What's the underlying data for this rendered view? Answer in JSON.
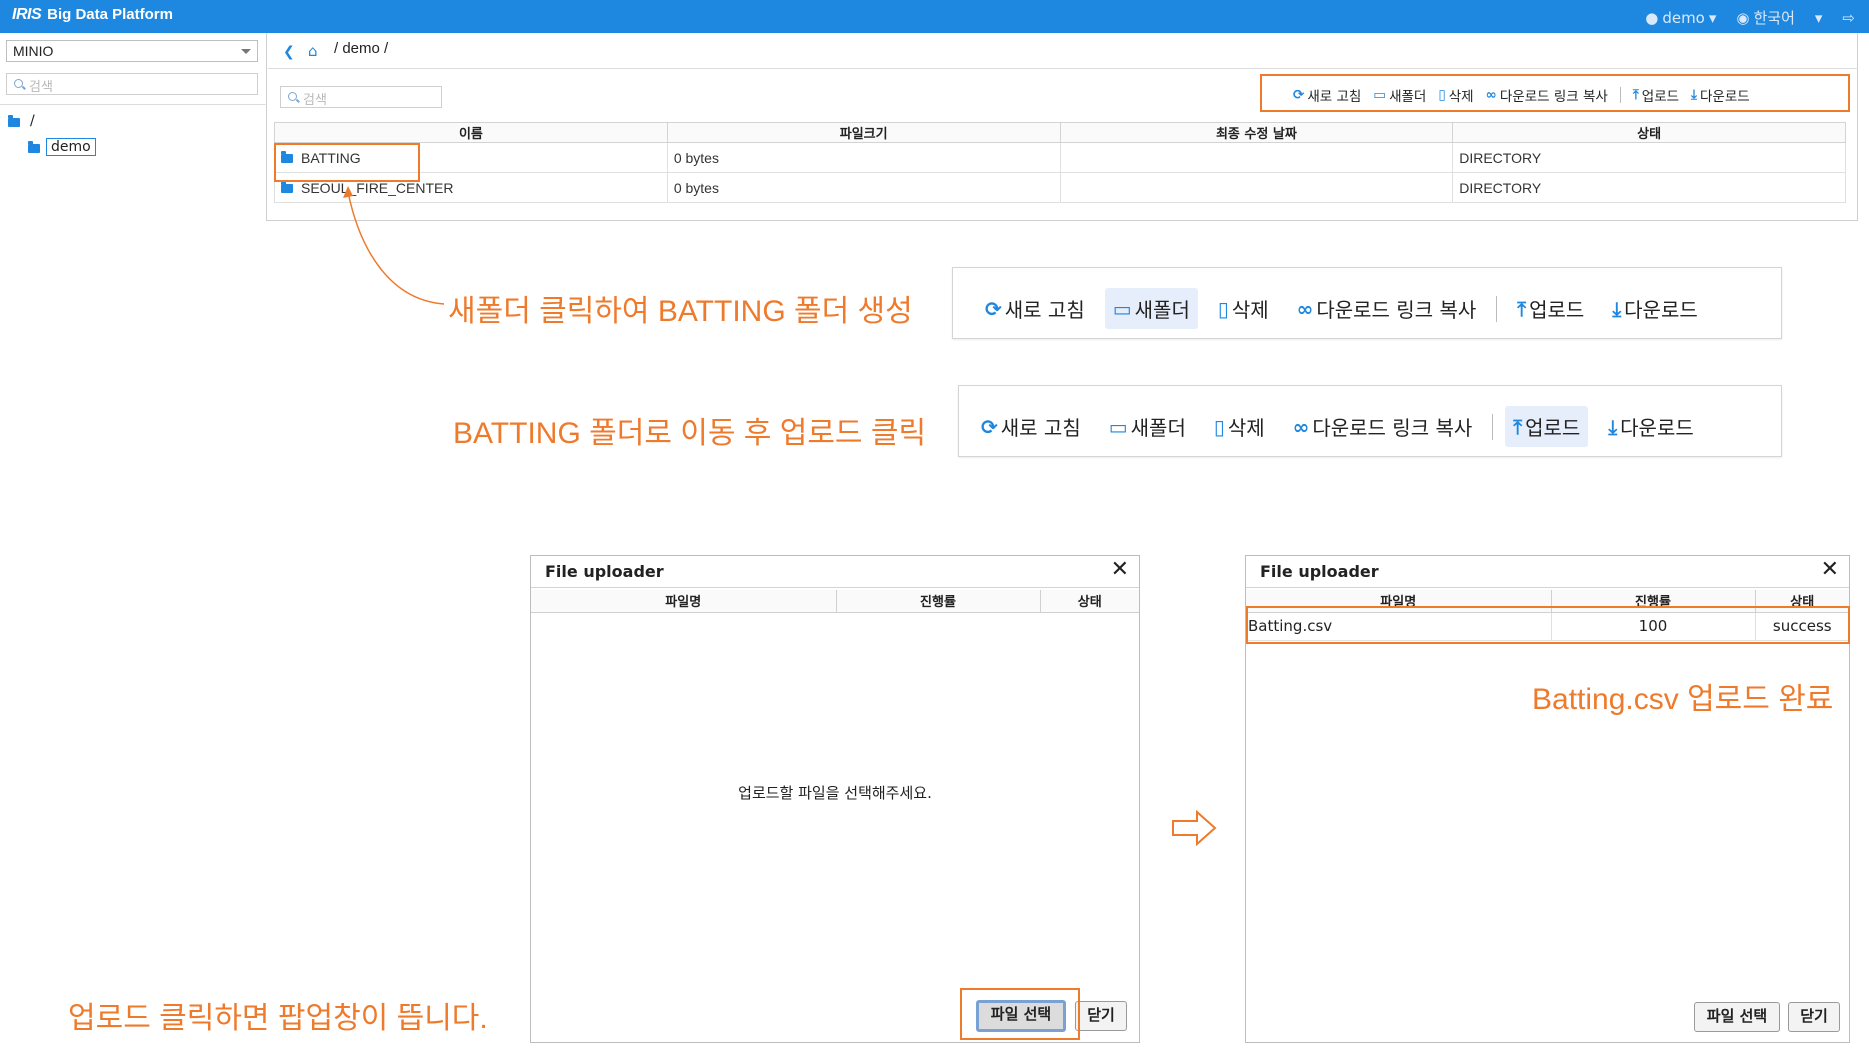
{
  "app": {
    "logo_mark": "IRIS",
    "title": "Big Data Platform",
    "user": "demo",
    "language": "한국어"
  },
  "sidebar": {
    "storage": "MINIO",
    "search_placeholder": "검색",
    "tree_root": "/",
    "tree_child": "demo"
  },
  "main": {
    "path": "/ demo /",
    "search_placeholder": "검색",
    "toolbar": {
      "refresh": "새로 고침",
      "new_folder": "새폴더",
      "delete": "삭제",
      "copy_link": "다운로드 링크 복사",
      "upload": "업로드",
      "download": "다운로드"
    },
    "columns": [
      "이름",
      "파일크기",
      "최종 수정 날짜",
      "상태"
    ],
    "rows": [
      {
        "name": "BATTING",
        "size": "0 bytes",
        "modified": "",
        "status": "DIRECTORY"
      },
      {
        "name": "SEOUL_FIRE_CENTER",
        "size": "0 bytes",
        "modified": "",
        "status": "DIRECTORY"
      }
    ]
  },
  "annotations": {
    "step1": "새폴더 클릭하여 BATTING 폴더 생성",
    "step2": "BATTING 폴더로 이동 후 업로드 클릭",
    "step3": "업로드 클릭하면 팝업창이 뜹니다.",
    "step4": "Batting.csv 업로드 완료",
    "accent_color": "#ee7a2c"
  },
  "uploader_empty": {
    "title": "File uploader",
    "columns": [
      "파일명",
      "진행률",
      "상태"
    ],
    "empty_message": "업로드할 파일을 선택해주세요.",
    "select_button": "파일 선택",
    "close_button": "닫기"
  },
  "uploader_done": {
    "title": "File uploader",
    "columns": [
      "파일명",
      "진행률",
      "상태"
    ],
    "file": {
      "name": "Batting.csv",
      "progress": "100",
      "status": "success"
    },
    "select_button": "파일 선택",
    "close_button": "닫기"
  },
  "icons": {
    "refresh": "refresh-icon",
    "new_folder": "folder-plus-icon",
    "delete": "trash-icon",
    "copy_link": "link-icon",
    "upload": "upload-icon",
    "download": "download-icon",
    "arrow": "right-arrow-icon"
  }
}
